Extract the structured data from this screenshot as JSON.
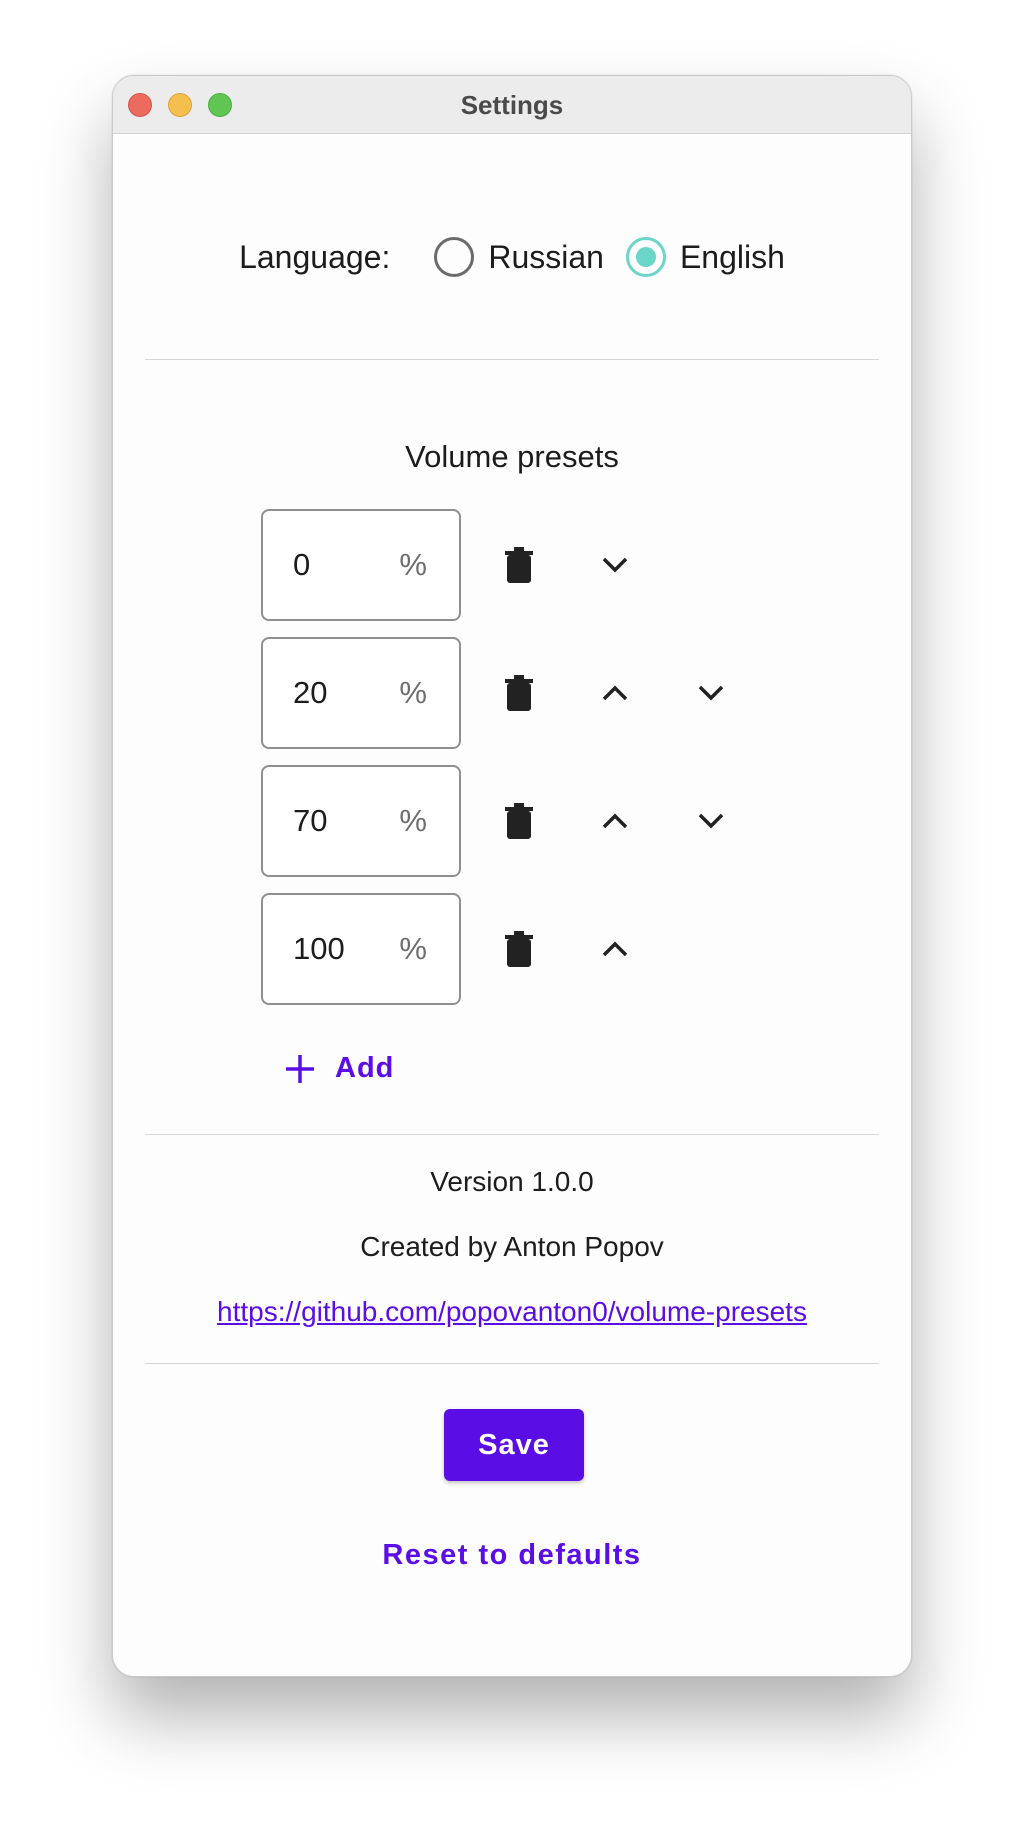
{
  "window": {
    "title": "Settings"
  },
  "language": {
    "label": "Language:",
    "options": [
      {
        "label": "Russian",
        "selected": false
      },
      {
        "label": "English",
        "selected": true
      }
    ]
  },
  "presets": {
    "title": "Volume presets",
    "unit": "%",
    "items": [
      "0",
      "20",
      "70",
      "100"
    ],
    "add_label": "Add"
  },
  "info": {
    "version": "Version 1.0.0",
    "author": "Created by Anton Popov",
    "link": "https://github.com/popovanton0/volume-presets"
  },
  "actions": {
    "save_label": "Save",
    "reset_label": "Reset to defaults"
  },
  "colors": {
    "accent": "#5a0ee5",
    "radio_selected": "#6ad5c8"
  }
}
